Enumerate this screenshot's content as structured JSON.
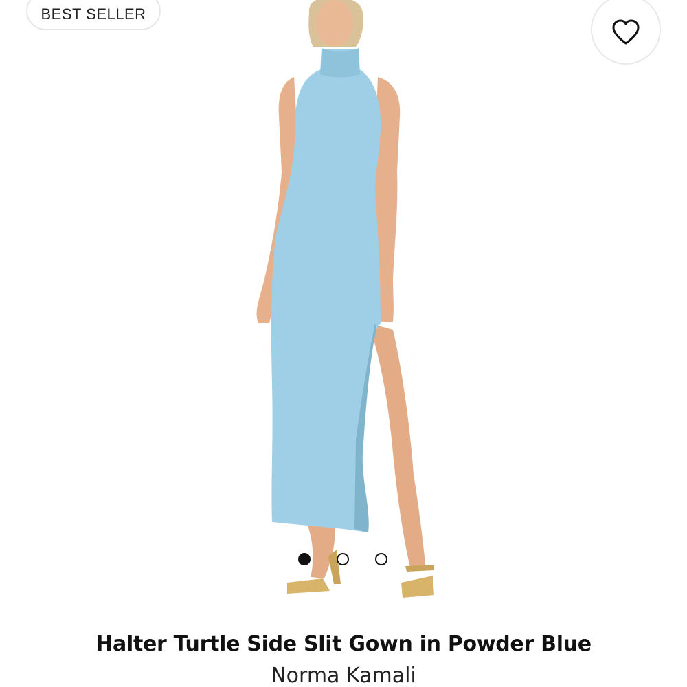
{
  "badge": {
    "label": "BEST SELLER"
  },
  "favorite": {
    "icon": "heart-icon",
    "active": false
  },
  "product": {
    "image": {
      "subject": "model-wearing-dress",
      "dress_color": "#9fcfe6"
    },
    "title": "Halter Turtle Side Slit Gown in Powder Blue",
    "brand": "Norma Kamali"
  },
  "carousel": {
    "count": 3,
    "active_index": 1
  },
  "colors": {
    "dress": "#9fcfe6",
    "skin": "#e8b48c",
    "sandal": "#d8b46a",
    "text": "#111111",
    "border": "#e6e6e6"
  }
}
